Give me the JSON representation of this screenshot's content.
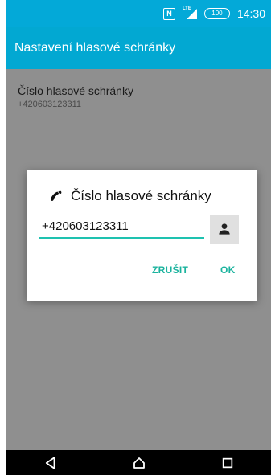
{
  "status_bar": {
    "nfc_label": "N",
    "network_label": "LTE",
    "battery_level": "100",
    "time": "14:30"
  },
  "toolbar": {
    "title": "Nastavení hlasové schránky"
  },
  "settings": {
    "item_title": "Číslo hlasové schránky",
    "item_summary": "+420603123311"
  },
  "dialog": {
    "title": "Číslo hlasové schránky",
    "number_value": "+420603123311",
    "cancel_label": "ZRUŠIT",
    "ok_label": "OK"
  },
  "nav_bar": {
    "icons": [
      "back-icon",
      "home-icon",
      "recent-apps-icon"
    ]
  },
  "colors": {
    "status_bar": "#03a9d8",
    "toolbar": "#02a8d2",
    "scrim_background": "#8f8f8f",
    "accent": "#1bb39e"
  }
}
